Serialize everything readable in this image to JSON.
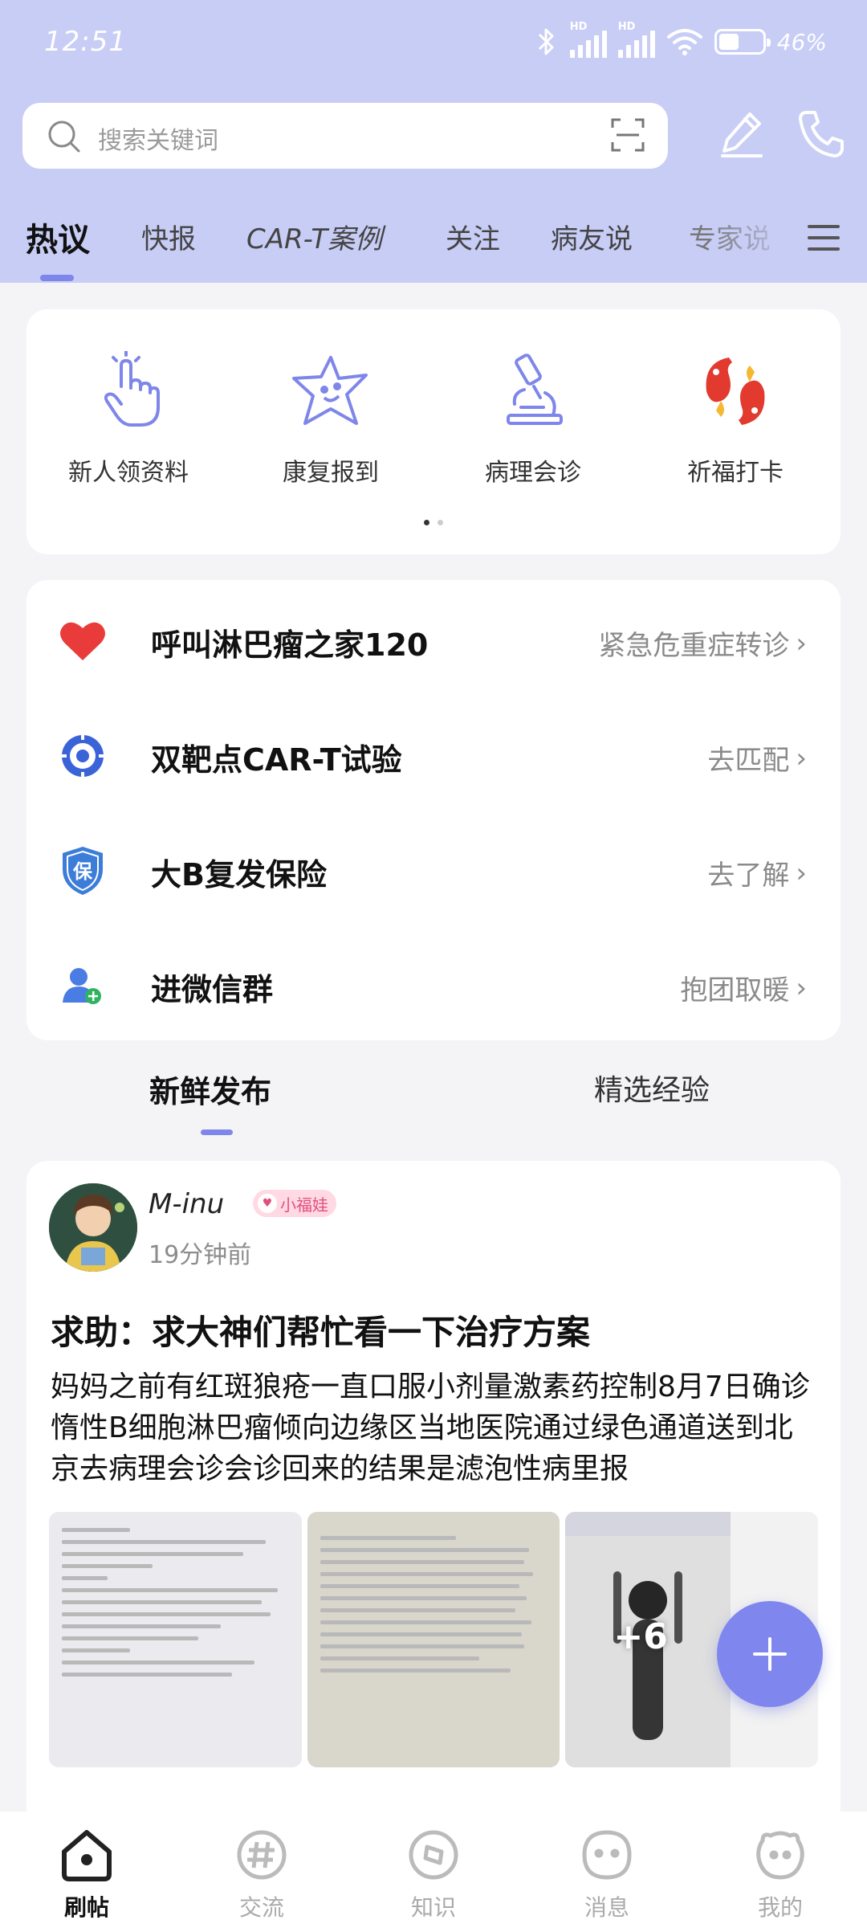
{
  "status_bar": {
    "time": "12:51",
    "battery_text": "46%",
    "signal_label_1": "HD",
    "signal_label_2": "HD",
    "battery_level": 0.46
  },
  "search": {
    "placeholder": "搜索关键词"
  },
  "tabs": [
    {
      "label": "热议",
      "active": true
    },
    {
      "label": "快报"
    },
    {
      "label": "CAR-T案例"
    },
    {
      "label": "关注"
    },
    {
      "label": "病友说"
    },
    {
      "label": "专家说"
    }
  ],
  "quick_actions": [
    {
      "label": "新人领资料",
      "icon": "tap-hand-icon"
    },
    {
      "label": "康复报到",
      "icon": "star-face-icon"
    },
    {
      "label": "病理会诊",
      "icon": "microscope-icon"
    },
    {
      "label": "祈福打卡",
      "icon": "koi-fish-icon"
    }
  ],
  "services": [
    {
      "title": "呼叫淋巴瘤之家120",
      "action": "紧急危重症转诊",
      "icon": "heart-icon"
    },
    {
      "title": "双靶点CAR-T试验",
      "action": "去匹配",
      "icon": "target-icon"
    },
    {
      "title": "大B复发保险",
      "action": "去了解",
      "icon": "shield-icon",
      "icon_text": "保"
    },
    {
      "title": "进微信群",
      "action": "抱团取暖",
      "icon": "add-user-icon"
    }
  ],
  "sub_tabs": [
    {
      "label": "新鲜发布",
      "active": true
    },
    {
      "label": "精选经验"
    }
  ],
  "post": {
    "author": "M-inu",
    "badge": "小福娃",
    "time": "19分钟前",
    "title": "求助：求大神们帮忙看一下治疗方案",
    "body": "妈妈之前有红斑狼疮一直口服小剂量激素药控制8月7日确诊惰性B细胞淋巴瘤倾向边缘区当地医院通过绿色通道送到北京去病理会诊会诊回来的结果是滤泡性病里报",
    "more_images": "+6"
  },
  "bottom_nav": [
    {
      "label": "刷帖",
      "active": true,
      "icon": "home-icon"
    },
    {
      "label": "交流",
      "icon": "hashtag-icon"
    },
    {
      "label": "知识",
      "icon": "compass-icon"
    },
    {
      "label": "消息",
      "icon": "chat-face-icon"
    },
    {
      "label": "我的",
      "icon": "profile-face-icon"
    }
  ],
  "colors": {
    "header_bg": "#c8cdf6",
    "accent": "#7e86ea",
    "fab": "#7f87ee"
  }
}
